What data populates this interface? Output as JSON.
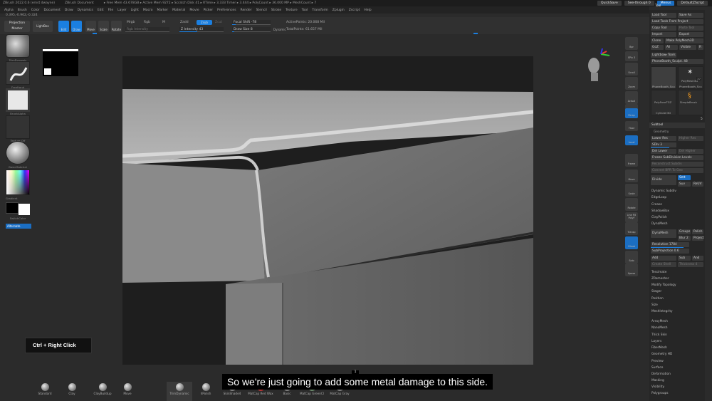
{
  "title_bar": {
    "app": "ZBrush 2022.0.6 (ernst dwayne)",
    "doc": "ZBrush Document",
    "stats": "▸ Free Mem 43.678GB ▸ Active Mem 9272 ▸ Scratch Disk 41 ▸ RTime ▸ 3.333 Timer ▸ 3.444 ▸ PolyCount ▸ 36.000 MP ▸ MeshCount ▸ 7",
    "quicksave": "QuickSave",
    "seethrough": "See-through 0",
    "menus_btn": "Menus",
    "defaultscript": "DefaultZScript"
  },
  "menu": [
    "Alpha",
    "Brush",
    "Color",
    "Document",
    "Draw",
    "Dynamics",
    "Edit",
    "File",
    "Layer",
    "Light",
    "Macro",
    "Marker",
    "Material",
    "Movie",
    "Picker",
    "Preferences",
    "Render",
    "Stencil",
    "Stroke",
    "Texture",
    "Tool",
    "Transform",
    "Zplugin",
    "Zscript",
    "Help"
  ],
  "coords": "0.395,-0.962,-0.324",
  "toolbar": {
    "projection_master": "Projection Master",
    "lightbox": "LightBox",
    "edit": "Edit",
    "draw": "Draw",
    "move": "Move",
    "scale": "Scale",
    "rotate": "Rotate",
    "mrgb": "Mrgb",
    "rgb": "Rgb",
    "m": "M",
    "rgb_intensity": "Rgb Intensity",
    "zadd": "Zadd",
    "zsub": "Zsub",
    "zcut": "Zcut",
    "z_intensity": "Z Intensity 43",
    "focal_shift": "Focal Shift -78",
    "draw_size": "Draw Size 8",
    "dynamic": "Dynamic",
    "active_points": "ActivePoints: 20.068 Mil",
    "total_points": "TotalPoints: 61.657 Mil"
  },
  "left_shelf": {
    "brush": "TrimDynamic",
    "stroke": "FreeHand",
    "alpha": "BrushAlpha",
    "texture": "Texture Off",
    "material": "BasicMaterial",
    "gradient": "Gradient",
    "switch_color": "SwitchColor",
    "alternate": "Alternate"
  },
  "right_icons": [
    "Bpr",
    "SPix 3",
    "Scroll",
    "Zoom",
    "Actual",
    "AAHalf",
    "Persp",
    "Floor",
    "Local",
    "Frame",
    "Move",
    "Scale",
    "Rotate",
    "Line Fill PolyF",
    "Transp",
    "Ghost",
    "Solo",
    "Xpose"
  ],
  "right_panel": {
    "tool_label": "Tool",
    "load_tool": "Load Tool",
    "save_as": "Save As",
    "load_from_project": "Load Tools From Project",
    "copy_tool": "Copy Tool",
    "paste_tool": "Paste Tool",
    "import": "Import",
    "export": "Export",
    "clone": "Clone",
    "make_polymesh": "Make PolyMesh3D",
    "goz": "GoZ",
    "all": "All",
    "visible": "Visible",
    "r": "R",
    "lightbox_tools": "Lightbox▸ Tools",
    "current_tool": "PhoneBooth_Sculpt. 48",
    "tool_tiles": [
      "PhoneBooth_Scu",
      "PolyMesh3D",
      "PhoneBooth_Scu",
      "SimpleBrush",
      "PolyFaceTGZ",
      "Cylinder3D"
    ],
    "tile_count": "37",
    "subtool_count": "5",
    "subtool_header": "Subtool",
    "geometry_header": "Geometry",
    "lower_res": "Lower Res",
    "higher_res": "Higher Res",
    "sdiv": "SDiv 3",
    "del_lower": "Del Lower",
    "del_higher": "Del Higher",
    "freeze_subdiv": "Freeze SubDivision Levels",
    "reconstruct": "Reconstruct Subdiv",
    "convert_bpr": "Convert BPR To Geo",
    "divide": "Divide",
    "smt": "Smt",
    "suv": "Suv",
    "reuv": "ReUV",
    "sections": [
      "Dynamic Subdiv",
      "EdgeLoop",
      "Crease",
      "ShadowBox",
      "ClayPolish",
      "DynaMesh"
    ],
    "dynamesh_btn": "DynaMesh",
    "groups": "Groups",
    "polish": "Polish",
    "blur": "Blur 2",
    "project": "Project",
    "resolution": "Resolution 1784",
    "subprojection": "SubProjection 0.6",
    "add": "Add",
    "sub": "Sub",
    "and": "And",
    "create_shell": "Create Shell",
    "thickness": "Thickness 4",
    "sections2": [
      "Tessimate",
      "ZRemesher",
      "Modify Topology",
      "Stager",
      "Position",
      "Size",
      "MeshIntegrity"
    ],
    "sections3": [
      "ArrayMesh",
      "NanoMesh",
      "Thick Skin",
      "Layers",
      "FiberMesh",
      "Geometry HD",
      "Preview",
      "Surface",
      "Deformation",
      "Masking",
      "Visibility",
      "Polygroups"
    ]
  },
  "bottom_shelf": [
    "Standard",
    "Clay",
    "ClayBuildup",
    "Move",
    "TrimDynamic",
    "hPolish",
    "SkinShade4",
    "MatCap Red Wax",
    "Basic",
    "MatCap GreenCl",
    "MatCap Gray"
  ],
  "hint": "Ctrl + Right Click",
  "subtitle": "So we're just going to add some metal damage to this side.",
  "subtitle_num": "1",
  "colors": {
    "accent": "#1b7fe0",
    "panel": "#262626",
    "bg": "#2b2b2b"
  }
}
